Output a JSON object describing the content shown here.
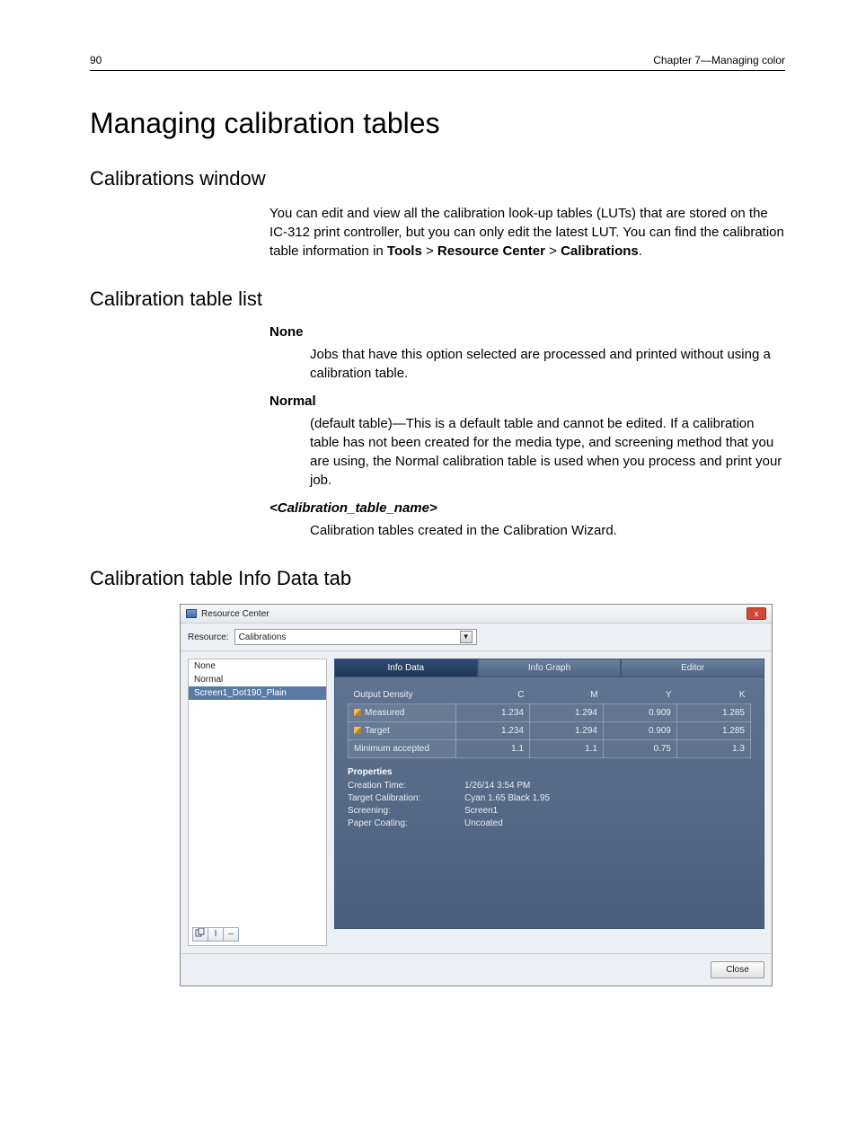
{
  "header": {
    "page_number": "90",
    "chapter": "Chapter 7—Managing color"
  },
  "h1": "Managing calibration tables",
  "sec1": {
    "title": "Calibrations window",
    "p1a": "You can edit and view all the calibration look-up tables (LUTs) that are stored on the IC-312 print controller, but you can only edit the latest LUT. You can find the calibration table information in ",
    "tools": "Tools",
    "gt1": " > ",
    "rc": "Resource Center",
    "gt2": " > ",
    "cal": "Calibrations",
    "p1b": "."
  },
  "sec2": {
    "title": "Calibration table list",
    "none_term": "None",
    "none_body": "Jobs that have this option selected are processed and printed without using a calibration table.",
    "normal_term": "Normal",
    "normal_body": "(default table)—This is a default table and cannot be edited. If a calibration table has not been created for the media type, and screening method that you are using, the Normal calibration table is used when you process and print your job.",
    "ctn_term": "<Calibration_table_name>",
    "ctn_body": "Calibration tables created in the Calibration Wizard."
  },
  "sec3": {
    "title": "Calibration table Info Data tab"
  },
  "window": {
    "title": "Resource Center",
    "close_x": "x",
    "resource_label": "Resource:",
    "resource_value": "Calibrations",
    "list": {
      "items": [
        "None",
        "Normal",
        "Screen1_Dot190_Plain"
      ],
      "selected_index": 2
    },
    "tool_rename": "I",
    "tool_delete": "–",
    "tabs": {
      "info_data": "Info Data",
      "info_graph": "Info Graph",
      "editor": "Editor"
    },
    "density": {
      "hdr_output": "Output Density",
      "hdr_C": "C",
      "hdr_M": "M",
      "hdr_Y": "Y",
      "hdr_K": "K",
      "rows": [
        {
          "label": "Measured",
          "pencil": true,
          "C": "1.234",
          "M": "1.294",
          "Y": "0.909",
          "K": "1.285"
        },
        {
          "label": "Target",
          "pencil": true,
          "C": "1.234",
          "M": "1.294",
          "Y": "0.909",
          "K": "1.285"
        },
        {
          "label": "Minimum accepted",
          "pencil": false,
          "C": "1.1",
          "M": "1.1",
          "Y": "0.75",
          "K": "1.3"
        }
      ]
    },
    "props": {
      "title": "Properties",
      "creation_time_l": "Creation Time:",
      "creation_time_v": "1/26/14 3:54 PM",
      "target_cal_l": "Target Calibration:",
      "target_cal_v": "Cyan 1.65  Black 1.95",
      "screening_l": "Screening:",
      "screening_v": "Screen1",
      "paper_l": "Paper Coating:",
      "paper_v": "Uncoated"
    },
    "close": "Close"
  }
}
